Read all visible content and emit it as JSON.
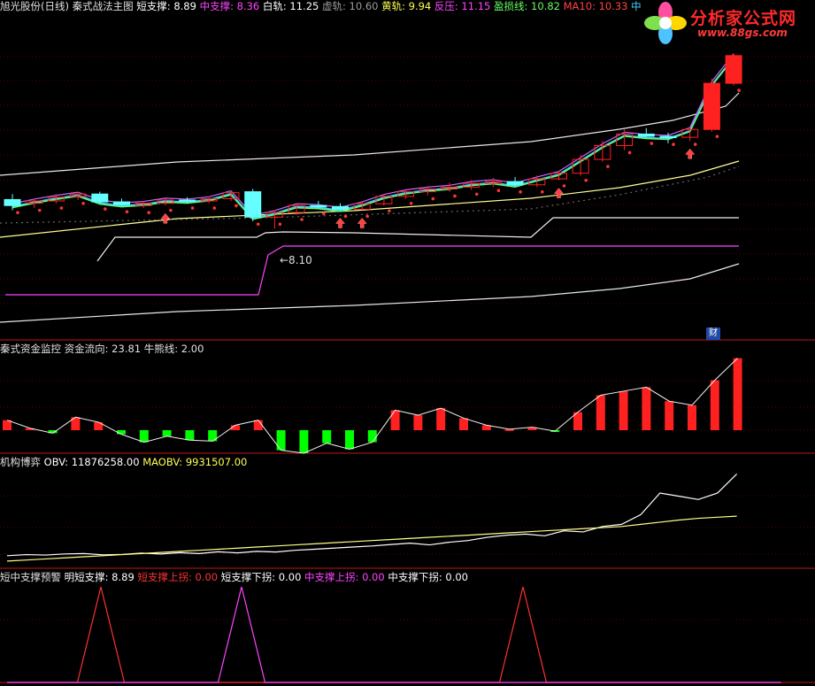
{
  "main_panel": {
    "header": [
      {
        "text": "旭光股份(日线)",
        "color": "#e0e0e0"
      },
      {
        "text": " 秦式战法主图 ",
        "color": "#e0e0e0"
      },
      {
        "text": " 短支撑: 8.89 ",
        "color": "#ffffff"
      },
      {
        "text": " 中支撑: 8.36 ",
        "color": "#ff44ff"
      },
      {
        "text": " 白轨: 11.25 ",
        "color": "#ffffff"
      },
      {
        "text": " 虚轨: 10.60 ",
        "color": "#9a9a9a"
      },
      {
        "text": " 黄轨: 9.94 ",
        "color": "#ffff55"
      },
      {
        "text": " 反压: 11.15 ",
        "color": "#ff44ff"
      },
      {
        "text": " 盈损线: 10.82 ",
        "color": "#66ff66"
      },
      {
        "text": " MA10: 10.33 ",
        "color": "#ff4444"
      },
      {
        "text": " 中",
        "color": "#40d0ff"
      }
    ],
    "price_label": "←8.10",
    "badge": "财"
  },
  "fund_panel": {
    "header": [
      {
        "text": "秦式资金监控 ",
        "color": "#e0e0e0"
      },
      {
        "text": " 资金流向: 23.81 ",
        "color": "#e0e0e0"
      },
      {
        "text": " 牛熊线: 2.00",
        "color": "#e0e0e0"
      }
    ]
  },
  "obv_panel": {
    "header": [
      {
        "text": "机构博弈 ",
        "color": "#e0e0e0"
      },
      {
        "text": " OBV: 11876258.00 ",
        "color": "#ffffff"
      },
      {
        "text": " MAOBV: 9931507.00",
        "color": "#ffff55"
      }
    ]
  },
  "alert_panel": {
    "header": [
      {
        "text": "短中支撑预警 ",
        "color": "#e0e0e0"
      },
      {
        "text": " 明短支撑: 8.89 ",
        "color": "#ffffff"
      },
      {
        "text": " 短支撑上拐: 0.00 ",
        "color": "#ff3333"
      },
      {
        "text": " 短支撑下拐: 0.00 ",
        "color": "#ffffff"
      },
      {
        "text": " 中支撑上拐: 0.00 ",
        "color": "#ff44ff"
      },
      {
        "text": " 中支撑下拐: 0.00",
        "color": "#ffffff"
      }
    ]
  },
  "logo": {
    "text": "分析家公式网",
    "url": "www.88gs.com"
  },
  "colors": {
    "up": "#ff2020",
    "down_candle": "#66ffff",
    "down_bar": "#00ff00",
    "axis": "#8b0000"
  },
  "chart_data": [
    {
      "type": "candlestick",
      "title": "秦式战法主图",
      "note": "daily candles, open/high/low/close",
      "candles": [
        [
          9.43,
          9.55,
          9.2,
          9.3
        ],
        [
          9.35,
          9.45,
          9.25,
          9.4
        ],
        [
          9.4,
          9.55,
          9.35,
          9.48
        ],
        [
          9.5,
          9.6,
          9.42,
          9.55
        ],
        [
          9.55,
          9.6,
          9.35,
          9.38
        ],
        [
          9.38,
          9.45,
          9.3,
          9.32
        ],
        [
          9.3,
          9.4,
          9.25,
          9.35
        ],
        [
          9.35,
          9.45,
          9.3,
          9.42
        ],
        [
          9.42,
          9.48,
          9.36,
          9.4
        ],
        [
          9.4,
          9.5,
          9.35,
          9.45
        ],
        [
          9.45,
          9.62,
          9.4,
          9.58
        ],
        [
          9.6,
          9.66,
          8.96,
          9.05
        ],
        [
          9.05,
          9.2,
          8.8,
          9.15
        ],
        [
          9.15,
          9.35,
          9.1,
          9.3
        ],
        [
          9.3,
          9.4,
          9.22,
          9.28
        ],
        [
          9.28,
          9.35,
          9.2,
          9.22
        ],
        [
          9.22,
          9.38,
          9.2,
          9.34
        ],
        [
          9.34,
          9.55,
          9.3,
          9.5
        ],
        [
          9.5,
          9.62,
          9.45,
          9.6
        ],
        [
          9.6,
          9.72,
          9.52,
          9.66
        ],
        [
          9.66,
          9.8,
          9.6,
          9.7
        ],
        [
          9.7,
          9.85,
          9.64,
          9.78
        ],
        [
          9.78,
          9.9,
          9.7,
          9.82
        ],
        [
          9.82,
          9.92,
          9.72,
          9.75
        ],
        [
          9.75,
          9.95,
          9.7,
          9.88
        ],
        [
          9.88,
          10.05,
          9.85,
          10.0
        ],
        [
          10.0,
          10.4,
          9.95,
          10.3
        ],
        [
          10.3,
          10.7,
          10.25,
          10.6
        ],
        [
          10.6,
          10.95,
          10.5,
          10.85
        ],
        [
          10.85,
          10.98,
          10.78,
          10.8
        ],
        [
          10.8,
          10.88,
          10.65,
          10.78
        ],
        [
          10.78,
          11.0,
          10.7,
          10.95
        ],
        [
          10.95,
          12.05,
          10.9,
          11.95
        ],
        [
          11.95,
          12.6,
          11.9,
          12.55
        ]
      ]
    },
    {
      "type": "bar",
      "title": "秦式资金监控",
      "series": [
        {
          "name": "资金流向",
          "values": [
            1.0,
            0.2,
            -0.3,
            1.3,
            0.8,
            -0.4,
            -1.2,
            -0.6,
            -1.0,
            -1.1,
            0.5,
            1.0,
            -2.0,
            -2.3,
            -1.3,
            -1.9,
            -1.2,
            2.0,
            1.5,
            2.2,
            1.2,
            0.5,
            0.1,
            0.3,
            -0.1,
            1.8,
            3.5,
            3.9,
            4.3,
            2.9,
            2.5,
            5.0,
            7.2
          ]
        }
      ],
      "reference": {
        "name": "牛熊线",
        "value": 2.0
      }
    },
    {
      "type": "line",
      "title": "机构博弈",
      "series": [
        {
          "name": "OBV",
          "values": [
            8.1,
            8.15,
            8.13,
            8.18,
            8.2,
            8.14,
            8.16,
            8.22,
            8.18,
            8.24,
            8.2,
            8.28,
            8.23,
            8.3,
            8.27,
            8.35,
            8.4,
            8.45,
            8.5,
            8.55,
            8.62,
            8.68,
            8.6,
            8.72,
            8.8,
            8.95,
            9.05,
            9.1,
            9.02,
            9.25,
            9.2,
            9.45,
            9.55,
            10.0,
            11.0,
            10.85,
            10.7,
            11.0,
            11.88
          ]
        },
        {
          "name": "MAOBV",
          "values": [
            7.85,
            7.9,
            7.95,
            8.0,
            8.05,
            8.1,
            8.15,
            8.2,
            8.25,
            8.3,
            8.35,
            8.4,
            8.45,
            8.5,
            8.55,
            8.6,
            8.65,
            8.7,
            8.75,
            8.8,
            8.85,
            8.9,
            8.95,
            9.0,
            9.05,
            9.1,
            9.15,
            9.2,
            9.25,
            9.3,
            9.35,
            9.4,
            9.45,
            9.55,
            9.65,
            9.75,
            9.83,
            9.88,
            9.93
          ]
        }
      ]
    },
    {
      "type": "line",
      "title": "短中支撑预警",
      "series": [
        {
          "name": "短支撑上拐",
          "values": [
            0,
            0,
            0,
            0,
            1,
            0,
            0,
            0,
            0,
            0,
            0,
            0,
            0,
            0,
            0,
            0,
            0,
            0,
            0,
            0,
            0,
            0,
            1,
            0,
            0,
            0,
            0,
            0,
            0,
            0,
            0,
            0,
            0,
            0
          ]
        },
        {
          "name": "中支撑上拐",
          "values": [
            0,
            0,
            0,
            0,
            0,
            0,
            0,
            0,
            0,
            0,
            1,
            0,
            0,
            0,
            0,
            0,
            0,
            0,
            0,
            0,
            0,
            0,
            0,
            0,
            0,
            0,
            0,
            0,
            0,
            0,
            0,
            0,
            0,
            0
          ]
        }
      ]
    }
  ]
}
